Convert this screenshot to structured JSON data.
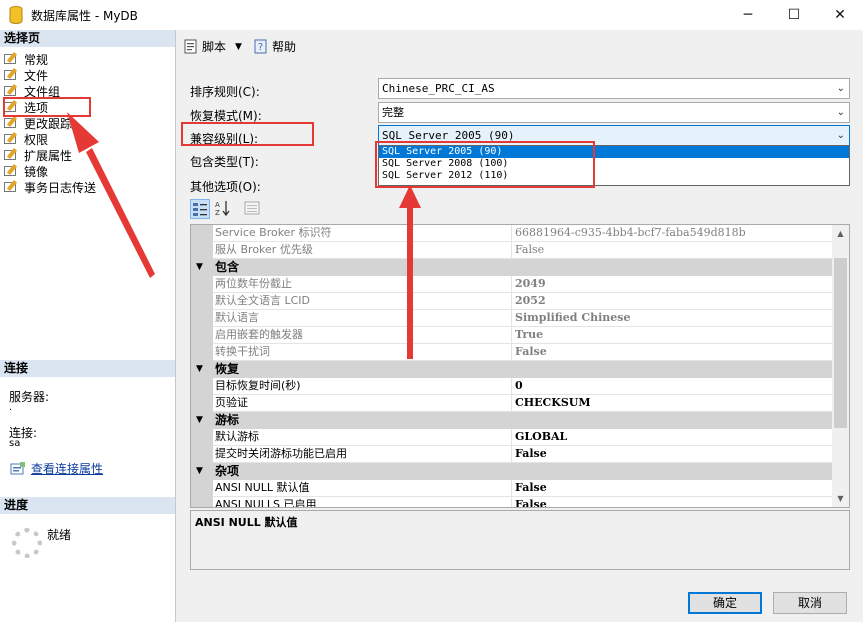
{
  "window": {
    "title": "数据库属性 - MyDB",
    "minimize_glyph": "─",
    "maximize_glyph": "☐",
    "close_glyph": "✕"
  },
  "left_panel": {
    "select_page_header": "选择页",
    "pages": [
      {
        "label": "常规"
      },
      {
        "label": "文件"
      },
      {
        "label": "文件组"
      },
      {
        "label": "选项"
      },
      {
        "label": "更改跟踪"
      },
      {
        "label": "权限"
      },
      {
        "label": "扩展属性"
      },
      {
        "label": "镜像"
      },
      {
        "label": "事务日志传送"
      }
    ],
    "connection_header": "连接",
    "server_label": "服务器:",
    "server_value": ".",
    "connection_label": "连接:",
    "connection_value": "sa",
    "view_connection_link": "查看连接属性",
    "progress_header": "进度",
    "progress_status": "就绪"
  },
  "toolbar": {
    "script_label": "脚本",
    "help_label": "帮助"
  },
  "properties": {
    "collation_label": "排序规则(C):",
    "collation_value": "Chinese_PRC_CI_AS",
    "recovery_label": "恢复模式(M):",
    "recovery_value": "完整",
    "compat_label": "兼容级别(L):",
    "compat_value": "SQL Server 2005 (90)",
    "containment_label": "包含类型(T):",
    "other_label": "其他选项(O):"
  },
  "compat_dropdown": {
    "options": [
      "SQL Server 2005 (90)",
      "SQL Server 2008 (100)",
      "SQL Server 2012 (110)"
    ],
    "selected_index": 0
  },
  "grid": {
    "rows": [
      {
        "kind": "row",
        "name": "Service Broker 标识符",
        "value": "66881964-c935-4bb4-bcf7-faba549d818b",
        "gray": true
      },
      {
        "kind": "row",
        "name": "服从 Broker 优先级",
        "value": "False",
        "gray": true
      },
      {
        "kind": "cat",
        "name": "包含",
        "toggle": "▼"
      },
      {
        "kind": "row",
        "name": "两位数年份截止",
        "value": "2049",
        "gray": true,
        "bold": true
      },
      {
        "kind": "row",
        "name": "默认全文语言 LCID",
        "value": "2052",
        "gray": true,
        "bold": true
      },
      {
        "kind": "row",
        "name": "默认语言",
        "value": "Simplified Chinese",
        "gray": true,
        "bold": true
      },
      {
        "kind": "row",
        "name": "启用嵌套的触发器",
        "value": "True",
        "gray": true,
        "bold": true
      },
      {
        "kind": "row",
        "name": "转换干扰词",
        "value": "False",
        "gray": true,
        "bold": true
      },
      {
        "kind": "cat",
        "name": "恢复",
        "toggle": "▼"
      },
      {
        "kind": "row",
        "name": "目标恢复时间(秒)",
        "value": "0",
        "bold": true
      },
      {
        "kind": "row",
        "name": "页验证",
        "value": "CHECKSUM",
        "bold": true
      },
      {
        "kind": "cat",
        "name": "游标",
        "toggle": "▼"
      },
      {
        "kind": "row",
        "name": "默认游标",
        "value": "GLOBAL",
        "bold": true
      },
      {
        "kind": "row",
        "name": "提交时关闭游标功能已启用",
        "value": "False",
        "bold": true
      },
      {
        "kind": "cat",
        "name": "杂项",
        "toggle": "▼"
      },
      {
        "kind": "row",
        "name": "ANSI NULL 默认值",
        "value": "False",
        "bold": true
      },
      {
        "kind": "row",
        "name": "ANSI NULLS 已启用",
        "value": "False",
        "bold": true
      }
    ]
  },
  "description": {
    "title": "ANSI NULL 默认值"
  },
  "buttons": {
    "ok": "确定",
    "cancel": "取消"
  },
  "colors": {
    "annotation_red": "#e53935",
    "selection_blue": "#0078d7",
    "section_header": "#dbe4f1"
  }
}
